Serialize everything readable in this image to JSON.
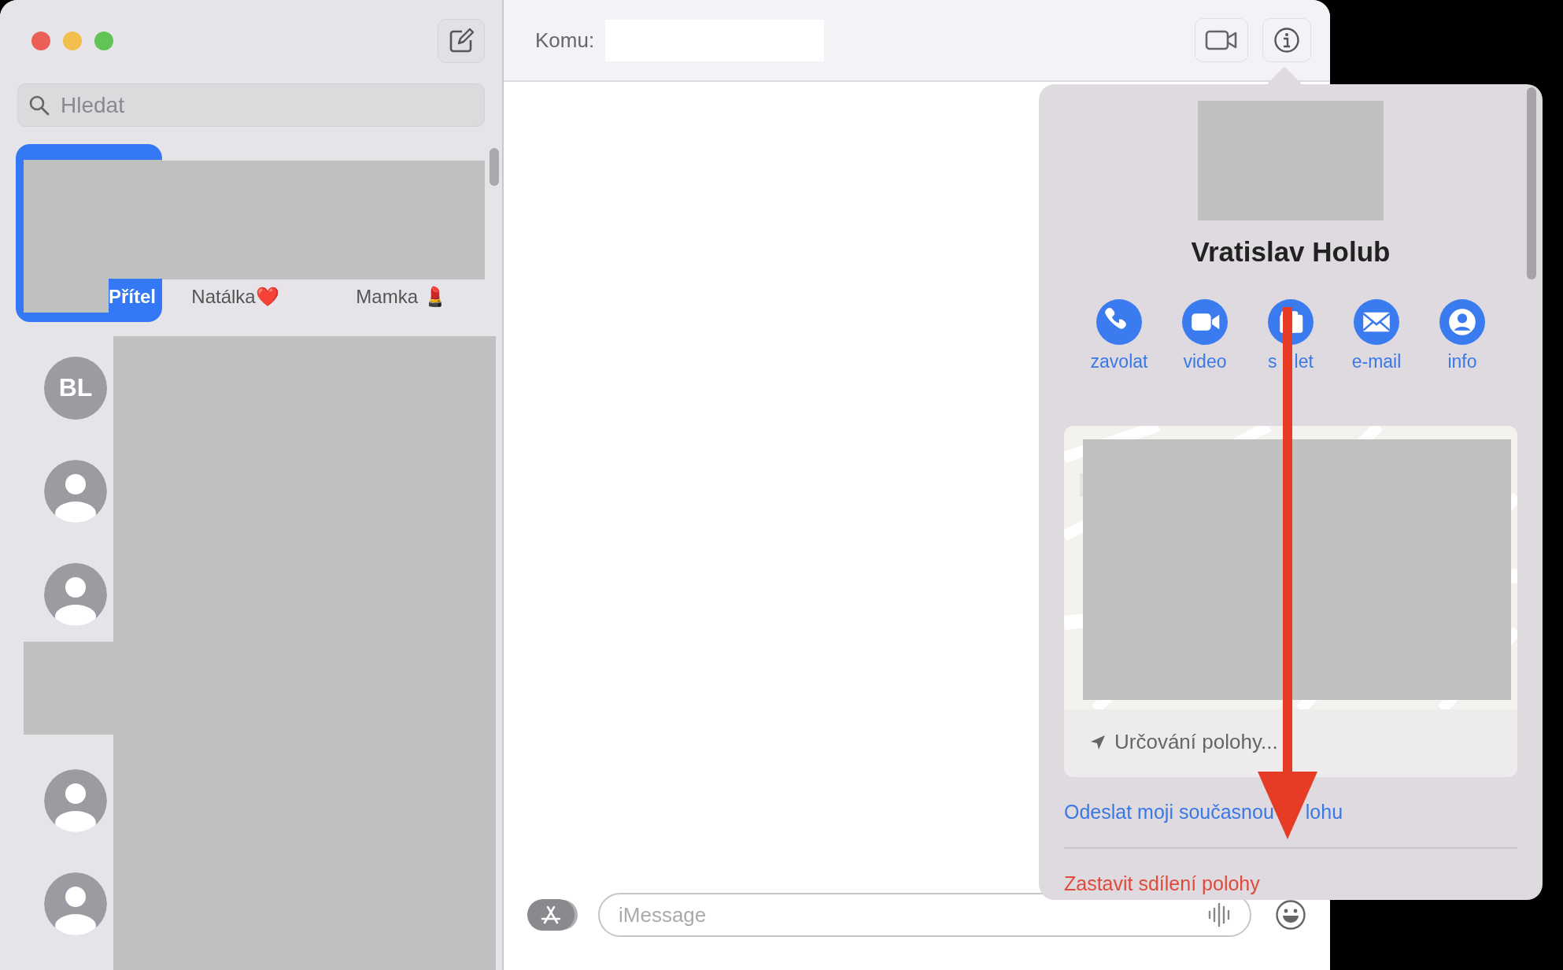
{
  "sidebar": {
    "search": {
      "placeholder": "Hledat"
    },
    "pinned": [
      {
        "label": "Přítel",
        "selected": true
      },
      {
        "label": "Natálka❤️",
        "selected": false
      },
      {
        "label": "Mamka 💄",
        "selected": false
      }
    ],
    "conversations": [
      {
        "kind": "initials",
        "initials": "BL"
      },
      {
        "kind": "person"
      },
      {
        "kind": "person"
      },
      {
        "kind": "person"
      },
      {
        "kind": "person"
      }
    ]
  },
  "header": {
    "to_label": "Komu:"
  },
  "composer": {
    "placeholder": "iMessage"
  },
  "details": {
    "name": "Vratislav Holub",
    "actions": [
      {
        "kind": "phone",
        "label": "zavolat"
      },
      {
        "kind": "video",
        "label": "video"
      },
      {
        "kind": "share",
        "label_parts": [
          "s",
          "let"
        ]
      },
      {
        "kind": "mail",
        "label": "e-mail"
      },
      {
        "kind": "info",
        "label": "info"
      }
    ],
    "location": {
      "kind": "picture",
      "status": "Určování polohy..."
    },
    "links": [
      {
        "kind": "primary",
        "label_parts": [
          "Odeslat moji současnou",
          "lohu"
        ]
      },
      {
        "kind": "destructive",
        "label": "Zastavit sdílení polohy"
      }
    ]
  }
}
